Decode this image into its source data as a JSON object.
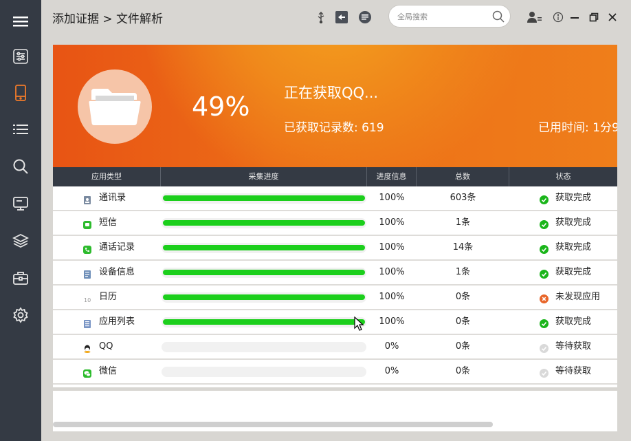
{
  "breadcrumb": {
    "text": "添加证据 > 文件解析"
  },
  "search": {
    "placeholder": "全局搜索"
  },
  "banner": {
    "percent": "49%",
    "status_title": "正在获取QQ...",
    "records": "已获取记录数: 619",
    "elapsed": "已用时间: 1分9"
  },
  "table": {
    "headers": [
      "应用类型",
      "采集进度",
      "进度信息",
      "总数",
      "状态"
    ],
    "rows": [
      {
        "app": "通讯录",
        "icon": "contacts-icon",
        "progress": 1.0,
        "progress_text": "100%",
        "total": "603条",
        "status": "获取完成",
        "status_kind": "done"
      },
      {
        "app": "短信",
        "icon": "sms-icon",
        "progress": 1.0,
        "progress_text": "100%",
        "total": "1条",
        "status": "获取完成",
        "status_kind": "done"
      },
      {
        "app": "通话记录",
        "icon": "phone-icon",
        "progress": 1.0,
        "progress_text": "100%",
        "total": "14条",
        "status": "获取完成",
        "status_kind": "done"
      },
      {
        "app": "设备信息",
        "icon": "device-info-icon",
        "progress": 1.0,
        "progress_text": "100%",
        "total": "1条",
        "status": "获取完成",
        "status_kind": "done"
      },
      {
        "app": "日历",
        "icon": "calendar-icon",
        "progress": 1.0,
        "progress_text": "100%",
        "total": "0条",
        "status": "未发现应用",
        "status_kind": "error"
      },
      {
        "app": "应用列表",
        "icon": "app-list-icon",
        "progress": 1.0,
        "progress_text": "100%",
        "total": "0条",
        "status": "获取完成",
        "status_kind": "done"
      },
      {
        "app": "QQ",
        "icon": "qq-icon",
        "progress": 0.0,
        "progress_text": "0%",
        "total": "0条",
        "status": "等待获取",
        "status_kind": "waiting"
      },
      {
        "app": "微信",
        "icon": "wechat-icon",
        "progress": 0.0,
        "progress_text": "0%",
        "total": "0条",
        "status": "等待获取",
        "status_kind": "waiting"
      }
    ]
  },
  "colors": {
    "sidebar": "#343a44",
    "sidebar_active": "#f07a2a",
    "progress_fill": "#1ccf1c",
    "status_done": "#1ab51a",
    "status_error": "#e8662a",
    "status_waiting": "#d9d9d9"
  }
}
